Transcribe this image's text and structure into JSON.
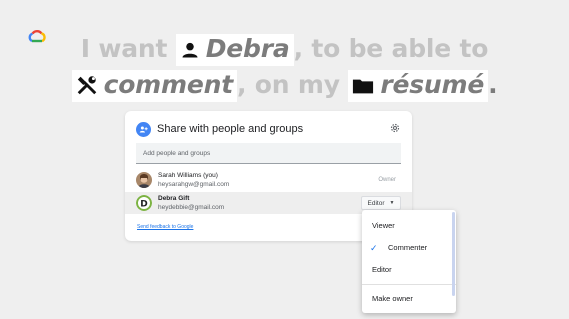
{
  "headline": {
    "line1_prefix": "I want ",
    "name_highlight": "Debra",
    "line1_suffix": ", to be able to",
    "action_highlight": "comment",
    "line2_middle": ", on my ",
    "file_highlight": "résumé",
    "period": "."
  },
  "share_dialog": {
    "title": "Share with people and groups",
    "add_placeholder": "Add people and groups",
    "people": [
      {
        "name": "Sarah Williams (you)",
        "email": "heysarahgw@gmail.com",
        "role": "Owner",
        "avatar": "photo"
      },
      {
        "name": "Debra Gift",
        "email": "heydebbie@gmail.com",
        "role": "Editor",
        "avatar_letter": "D",
        "avatar_color": "#7cb342"
      }
    ],
    "feedback_link": "Send feedback to Google"
  },
  "role_menu": {
    "items": [
      "Viewer",
      "Commenter",
      "Editor"
    ],
    "selected": "Commenter",
    "make_owner": "Make owner"
  },
  "colors": {
    "accent": "#1a73e8",
    "headline_gray": "#c3c3c3",
    "highlight_text": "#7c7c7c",
    "background": "#efefef"
  }
}
